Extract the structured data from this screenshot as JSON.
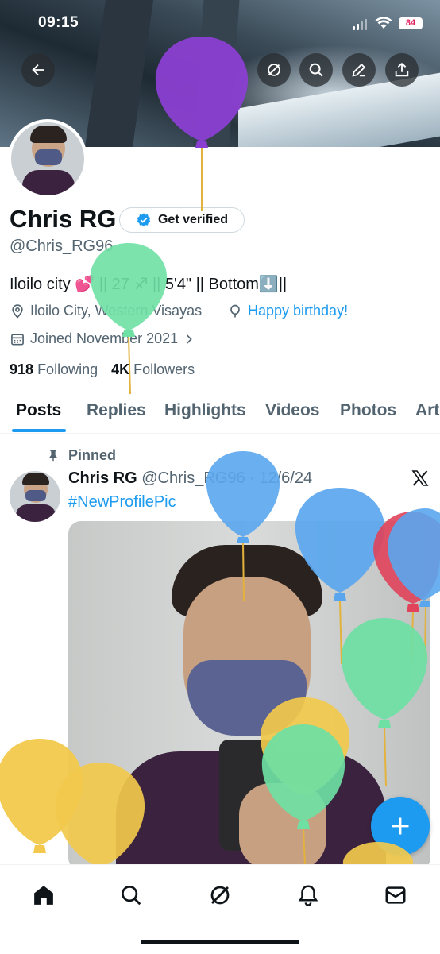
{
  "status_bar": {
    "time": "09:15",
    "battery": "84"
  },
  "profile": {
    "name": "Chris RG",
    "verify_label": "Get verified",
    "handle": "@Chris_RG96",
    "bio_part1": "Iloilo city 💕 || 27 ♐ || 5'4\" || Bottom⬇️||",
    "location": "Iloilo City, Western Visayas",
    "birthday_link": "Happy birthday!",
    "joined": "Joined November 2021",
    "following_count": "918",
    "following_label": "Following",
    "followers_count": "4K",
    "followers_label": "Followers"
  },
  "tabs": [
    "Posts",
    "Replies",
    "Highlights",
    "Videos",
    "Photos",
    "Art"
  ],
  "active_tab": "Posts",
  "pinned_post": {
    "pinned_label": "Pinned",
    "author": "Chris RG",
    "handle_date": "@Chris_RG96 · 12/6/24",
    "hashtag": "#NewProfilePic"
  },
  "icons": {
    "header": [
      "back-arrow-icon",
      "grok-icon",
      "search-icon",
      "edit-icon",
      "share-icon"
    ],
    "bottom_nav": [
      "home-icon",
      "search-icon",
      "grok-icon",
      "notifications-icon",
      "messages-icon"
    ],
    "fab": "plus-icon",
    "post_menu": "x-logo-icon"
  },
  "colors": {
    "accent": "#1d9bf0",
    "text": "#0f1419",
    "secondary": "#536471"
  }
}
